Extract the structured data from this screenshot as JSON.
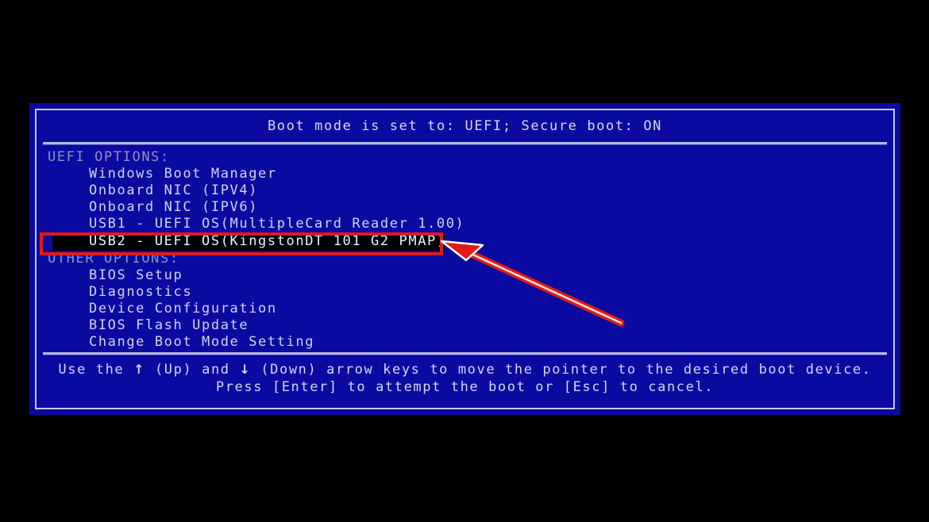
{
  "screen": {
    "background_color": "#000000",
    "panel_color": "#0a0aa0",
    "panel_border_color": "#c8c8e8",
    "text_color": "#d2d2ef",
    "dim_text_color": "#8f8fbe",
    "selection_background": "#000000",
    "annotation_color": "#e01b14"
  },
  "header": {
    "status_line": "Boot mode is set to: UEFI; Secure boot: ON"
  },
  "menu": {
    "groups": [
      {
        "label": "UEFI OPTIONS:",
        "items": [
          {
            "label": "Windows Boot Manager",
            "selected": false
          },
          {
            "label": "Onboard NIC (IPV4)",
            "selected": false
          },
          {
            "label": "Onboard NIC (IPV6)",
            "selected": false
          },
          {
            "label": "USB1 - UEFI OS(MultipleCard Reader 1.00)",
            "selected": false
          },
          {
            "label": "USB2 - UEFI OS(KingstonDT 101 G2 PMAP)",
            "selected": true
          }
        ]
      },
      {
        "label": "OTHER OPTIONS:",
        "items": [
          {
            "label": "BIOS Setup",
            "selected": false
          },
          {
            "label": "Diagnostics",
            "selected": false
          },
          {
            "label": "Device Configuration",
            "selected": false
          },
          {
            "label": "BIOS Flash Update",
            "selected": false
          },
          {
            "label": "Change Boot Mode Setting",
            "selected": false
          }
        ]
      }
    ]
  },
  "footer": {
    "line1_part1": "Use the ",
    "up_arrow": "↑",
    "line1_part2": " (Up) and ",
    "down_arrow": "↓",
    "line1_part3": " (Down) arrow keys to move the pointer to the desired boot device.",
    "line2": "Press [Enter] to attempt the boot or [Esc] to cancel."
  },
  "annotations": {
    "highlight_box_target": "USB2 - UEFI OS(KingstonDT 101 G2 PMAP)",
    "arrow_name": "red-pointer-arrow"
  }
}
